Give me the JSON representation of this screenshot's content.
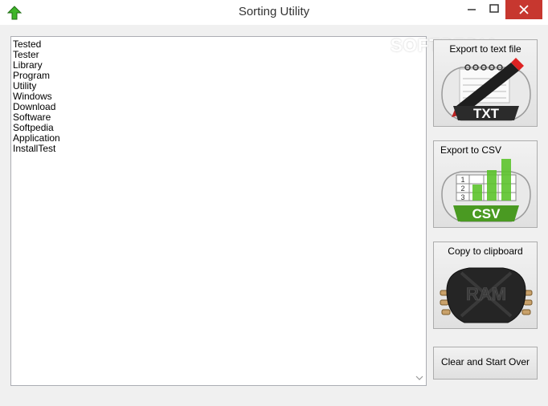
{
  "window": {
    "title": "Sorting Utility",
    "app_icon": "green-up-arrow-icon",
    "controls": [
      "minimize-icon",
      "maximize-icon",
      "close-icon"
    ]
  },
  "list": {
    "items": [
      "Tested",
      "Tester",
      "Library",
      "Program",
      "Utility",
      "Windows",
      "Download",
      "Software",
      "Softpedia",
      "Application",
      "InstallTest"
    ]
  },
  "buttons": {
    "export_txt": {
      "label": "Export to text file",
      "badge": "TXT",
      "icon": "notepad-pen-icon"
    },
    "export_csv": {
      "label": "Export to CSV",
      "badge": "CSV",
      "icon": "spreadsheet-chart-icon",
      "grid_rows": [
        "1",
        "2",
        "3"
      ]
    },
    "copy_clipboard": {
      "label": "Copy to clipboard",
      "badge": "RAM",
      "icon": "ram-chip-icon"
    },
    "clear": {
      "label": "Clear and Start Over"
    }
  },
  "watermark": "SOFTPEDIA",
  "colors": {
    "close": "#c7372f",
    "accent_green": "#5cc32c",
    "dark_badge": "#2b2b2b"
  }
}
